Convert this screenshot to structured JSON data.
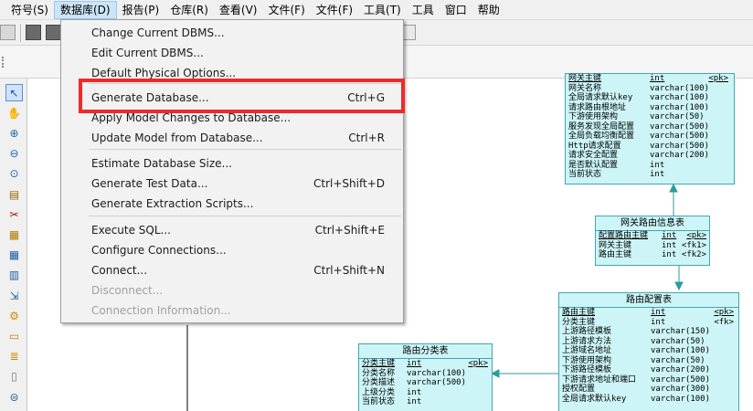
{
  "menubar": {
    "items": [
      "符号(S)",
      "数据库(D)",
      "报告(P)",
      "仓库(R)",
      "查看(V)",
      "文件(F)",
      "文件(F)",
      "工具(T)",
      "工具",
      "窗口",
      "帮助"
    ]
  },
  "database_menu": {
    "items": [
      {
        "label": "Change Current DBMS...",
        "shortcut": "",
        "disabled": false
      },
      {
        "label": "Edit Current DBMS...",
        "shortcut": "",
        "disabled": false
      },
      {
        "label": "Default Physical Options...",
        "shortcut": "",
        "disabled": false
      },
      {
        "label": "Generate Database...",
        "shortcut": "Ctrl+G",
        "disabled": false
      },
      {
        "label": "Apply Model Changes to Database...",
        "shortcut": "",
        "disabled": false
      },
      {
        "label": "Update Model from Database...",
        "shortcut": "Ctrl+R",
        "disabled": false
      },
      {
        "label": "Estimate Database Size...",
        "shortcut": "",
        "disabled": false
      },
      {
        "label": "Generate Test Data...",
        "shortcut": "Ctrl+Shift+D",
        "disabled": false
      },
      {
        "label": "Generate Extraction Scripts...",
        "shortcut": "",
        "disabled": false
      },
      {
        "label": "Execute SQL...",
        "shortcut": "Ctrl+Shift+E",
        "disabled": false
      },
      {
        "label": "Configure Connections...",
        "shortcut": "",
        "disabled": false
      },
      {
        "label": "Connect...",
        "shortcut": "Ctrl+Shift+N",
        "disabled": false
      },
      {
        "label": "Disconnect...",
        "shortcut": "",
        "disabled": true
      },
      {
        "label": "Connection Information...",
        "shortcut": "",
        "disabled": true
      }
    ]
  },
  "palette": {
    "icons": [
      "pointer-icon",
      "hand-icon",
      "zoom-in-icon",
      "zoom-out-icon",
      "zoom-fit-icon",
      "properties-icon",
      "scissors-icon",
      "package-icon",
      "table-icon",
      "view-icon",
      "reference-icon",
      "procedure-icon",
      "note-icon",
      "text-icon",
      "file-icon",
      "link-icon"
    ]
  },
  "entities": {
    "gateway_table": {
      "title": "",
      "columns": [
        {
          "name": "网关主键",
          "type": "int",
          "key": "<pk>",
          "pk": true
        },
        {
          "name": "网关名称",
          "type": "varchar(100)",
          "key": ""
        },
        {
          "name": "全局请求默认key",
          "type": "varchar(100)",
          "key": ""
        },
        {
          "name": "请求路由根地址",
          "type": "varchar(100)",
          "key": ""
        },
        {
          "name": "下游使用架构",
          "type": "varchar(50)",
          "key": ""
        },
        {
          "name": "服务发现全局配置",
          "type": "varchar(500)",
          "key": ""
        },
        {
          "name": "全局负载均衡配置",
          "type": "varchar(500)",
          "key": ""
        },
        {
          "name": "Http请求配置",
          "type": "varchar(500)",
          "key": ""
        },
        {
          "name": "请求安全配置",
          "type": "varchar(200)",
          "key": ""
        },
        {
          "name": "是否默认配置",
          "type": "int",
          "key": ""
        },
        {
          "name": "当前状态",
          "type": "int",
          "key": ""
        }
      ]
    },
    "gateway_route_info": {
      "title": "网关路由信息表",
      "columns": [
        {
          "name": "配置路由主键",
          "type": "int",
          "key": "<pk>",
          "pk": true
        },
        {
          "name": "网关主键",
          "type": "int",
          "key": "<fk1>"
        },
        {
          "name": "路由主键",
          "type": "int",
          "key": "<fk2>"
        }
      ]
    },
    "route_config": {
      "title": "路由配置表",
      "columns": [
        {
          "name": "路由主键",
          "type": "int",
          "key": "<pk>",
          "pk": true
        },
        {
          "name": "分类主键",
          "type": "int",
          "key": "<fk>"
        },
        {
          "name": "上游路径模板",
          "type": "varchar(150)",
          "key": ""
        },
        {
          "name": "上游请求方法",
          "type": "varchar(50)",
          "key": ""
        },
        {
          "name": "上游域名地址",
          "type": "varchar(100)",
          "key": ""
        },
        {
          "name": "下游使用架构",
          "type": "varchar(50)",
          "key": ""
        },
        {
          "name": "下游路径模板",
          "type": "varchar(200)",
          "key": ""
        },
        {
          "name": "下游请求地址和端口",
          "type": "varchar(500)",
          "key": ""
        },
        {
          "name": "授权配置",
          "type": "varchar(300)",
          "key": ""
        },
        {
          "name": "全局请求默认key",
          "type": "varchar(100)",
          "key": ""
        }
      ]
    },
    "route_category": {
      "title": "路由分类表",
      "columns": [
        {
          "name": "分类主键",
          "type": "int",
          "key": "<pk>",
          "pk": true
        },
        {
          "name": "分类名称",
          "type": "varchar(100)",
          "key": ""
        },
        {
          "name": "分类描述",
          "type": "varchar(500)",
          "key": ""
        },
        {
          "name": "上级分类",
          "type": "int",
          "key": ""
        },
        {
          "name": "当前状态",
          "type": "int",
          "key": ""
        }
      ]
    }
  },
  "colors": {
    "entity_fill": "#cdf5f7",
    "entity_border": "#3fa7b0",
    "link": "#2a9d9d",
    "highlight": "#ee2a2a",
    "menu_active": "#cce4f7"
  }
}
